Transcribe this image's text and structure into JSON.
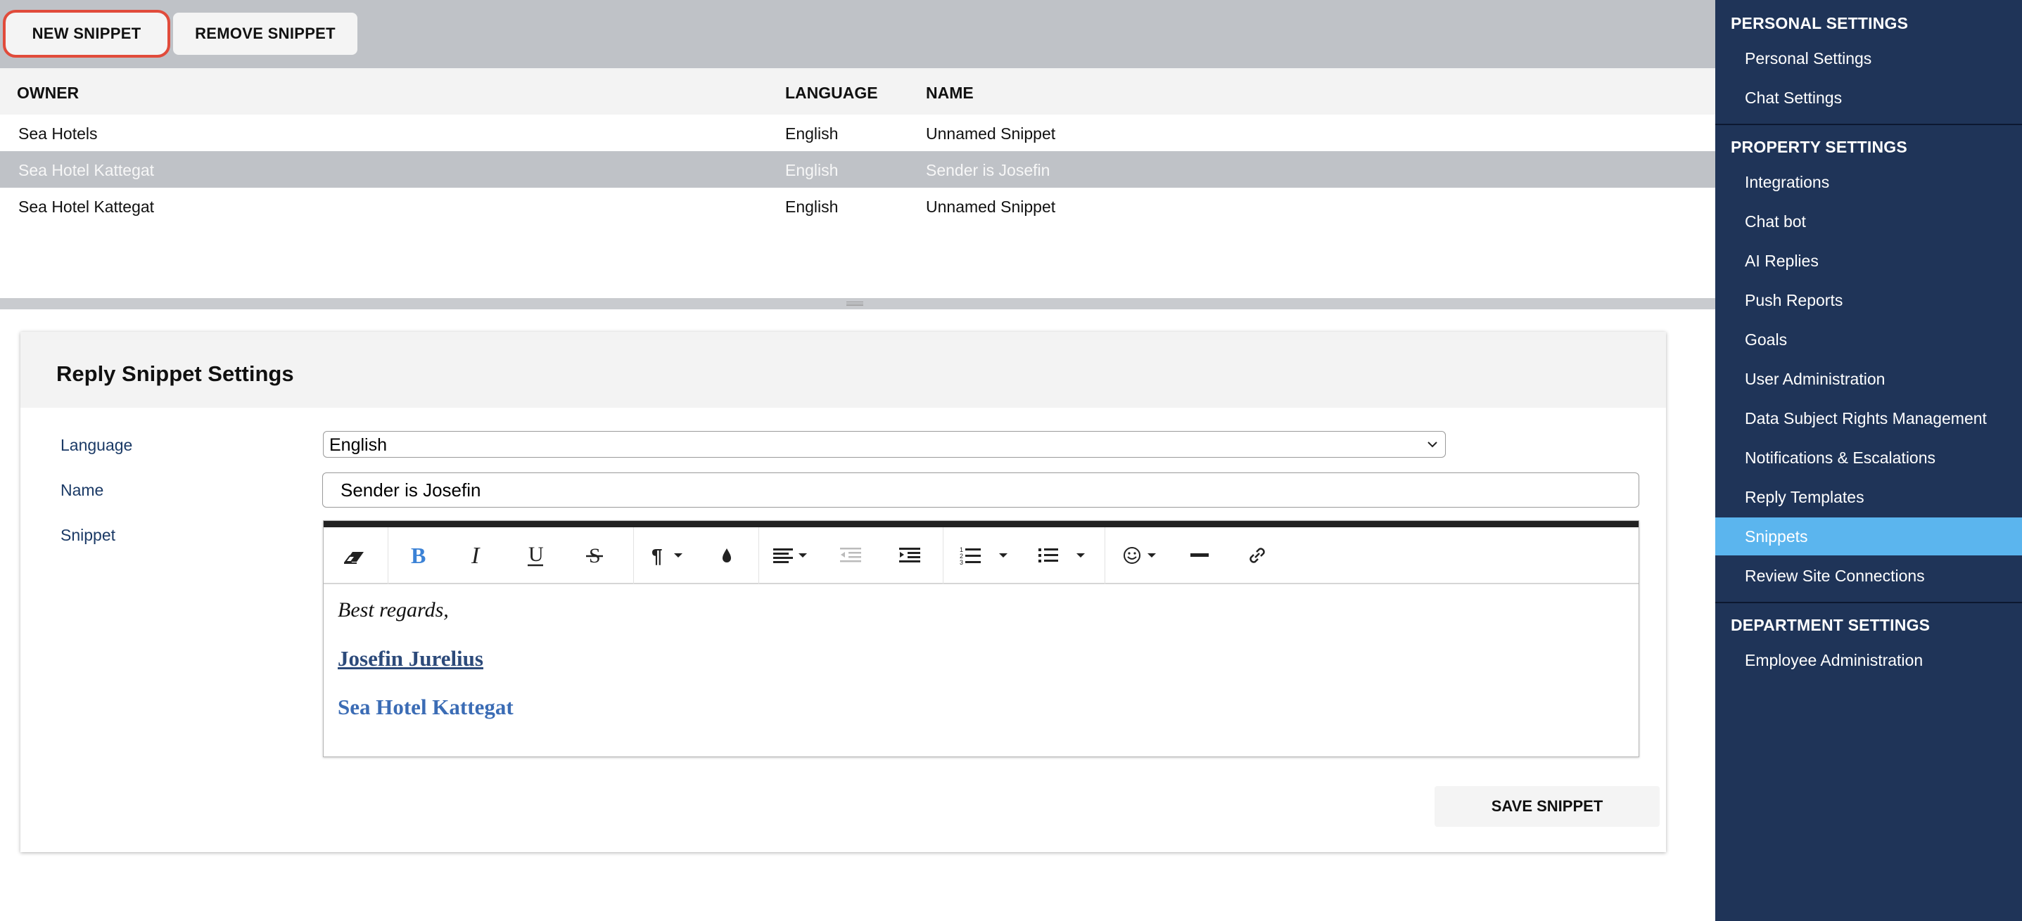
{
  "toolbar": {
    "new_label": "NEW SNIPPET",
    "remove_label": "REMOVE SNIPPET"
  },
  "table": {
    "headers": {
      "owner": "OWNER",
      "language": "LANGUAGE",
      "name": "NAME"
    },
    "rows": [
      {
        "owner": "Sea Hotels",
        "language": "English",
        "name": "Unnamed Snippet"
      },
      {
        "owner": "Sea Hotel Kattegat",
        "language": "English",
        "name": "Sender is Josefin"
      },
      {
        "owner": "Sea Hotel Kattegat",
        "language": "English",
        "name": "Unnamed Snippet"
      }
    ],
    "selected_row": 1
  },
  "panel": {
    "title": "Reply Snippet Settings",
    "language_label": "Language",
    "language_value": "English",
    "name_label": "Name",
    "name_value": "Sender is Josefin",
    "snippet_label": "Snippet",
    "snippet_lines": [
      "Best regards,",
      "Josefin Jurelius",
      "Sea Hotel Kattegat"
    ],
    "save_label": "SAVE SNIPPET"
  },
  "editor_toolbar": [
    "eraser-icon",
    "bold-icon",
    "italic-icon",
    "underline-icon",
    "strikethrough-icon",
    "paragraph-icon",
    "text-color-icon",
    "align-icon",
    "outdent-icon",
    "indent-icon",
    "ordered-list-icon",
    "unordered-list-icon",
    "emoji-icon",
    "horizontal-rule-icon",
    "link-icon"
  ],
  "sidebar": {
    "sections": [
      {
        "heading": "PERSONAL SETTINGS",
        "items": [
          "Personal Settings",
          "Chat Settings"
        ]
      },
      {
        "heading": "PROPERTY SETTINGS",
        "items": [
          "Integrations",
          "Chat bot",
          "AI Replies",
          "Push Reports",
          "Goals",
          "User Administration",
          "Data Subject Rights Management",
          "Notifications & Escalations",
          "Reply Templates",
          "Snippets",
          "Review Site Connections"
        ]
      },
      {
        "heading": "DEPARTMENT SETTINGS",
        "items": [
          "Employee Administration"
        ]
      }
    ],
    "active_item": "Snippets"
  },
  "colors": {
    "sidebar_bg": "#1f3458",
    "sidebar_active": "#5bb5ee",
    "toolbar_bg": "#bfc2c7",
    "selected_row_bg": "#bfc2c7",
    "highlight_outline": "#e14b3b",
    "bold_icon": "#3b82d6"
  }
}
